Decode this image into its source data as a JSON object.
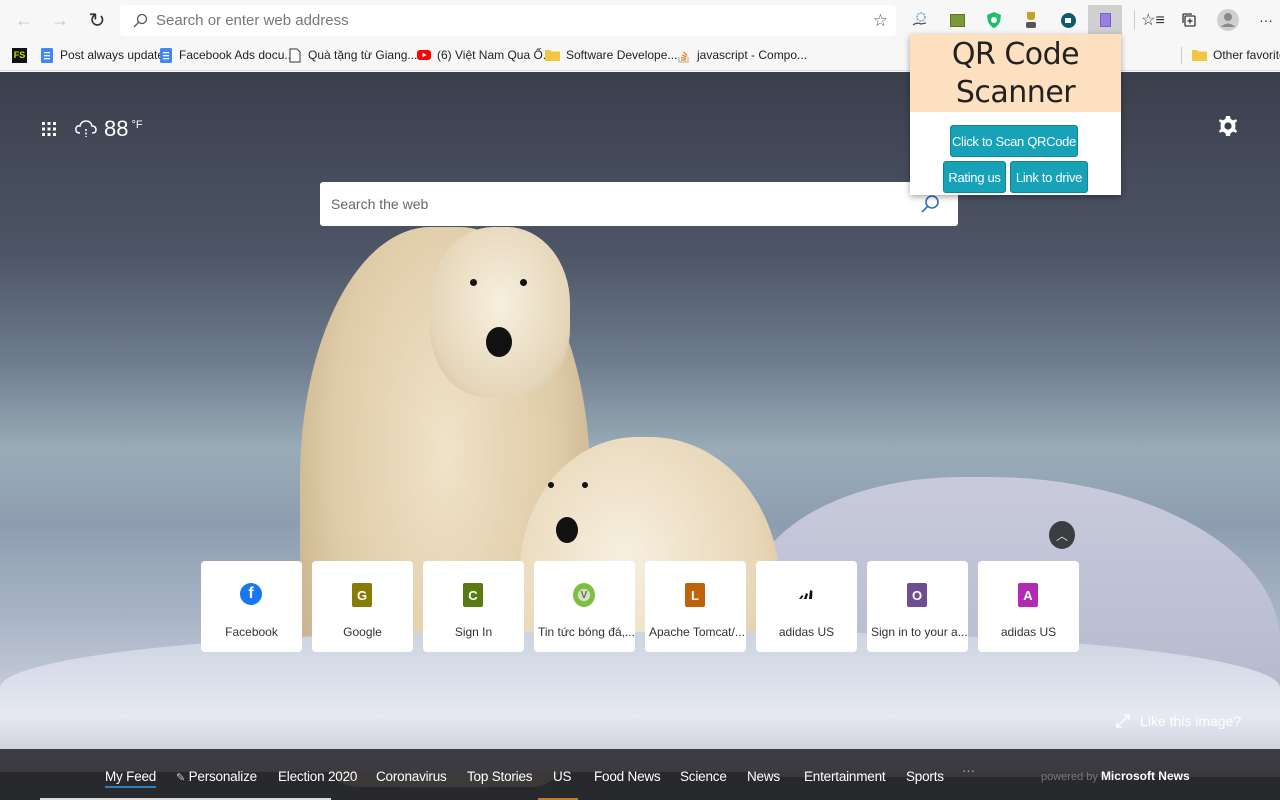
{
  "browser": {
    "address_placeholder": "Search or enter web address",
    "extensions": [
      "brain-hand-extension",
      "green-card-extension",
      "shield-extension",
      "trophy-extension",
      "video-extension",
      "qr-scanner-extension"
    ],
    "bookmarks": [
      {
        "label": "",
        "icon": "fs-icon"
      },
      {
        "label": "Post always update",
        "icon": "docs-icon"
      },
      {
        "label": "Facebook Ads docu...",
        "icon": "docs-icon"
      },
      {
        "label": "Quà tặng từ Giang...",
        "icon": "page-icon"
      },
      {
        "label": "(6) Việt Nam Qua Ố...",
        "icon": "youtube-icon"
      },
      {
        "label": "Software Develope...",
        "icon": "folder-icon"
      },
      {
        "label": "javascript - Compo...",
        "icon": "stackoverflow-icon"
      }
    ],
    "other_favorites": "Other favorites"
  },
  "popup": {
    "title": "QR Code Scanner",
    "scan_button": "Click to Scan QRCode",
    "rating_button": "Rating us",
    "drive_button": "Link to drive",
    "accent": "#17a2b8",
    "header_bg": "#fde0bf"
  },
  "newtab": {
    "weather": {
      "temp": "88",
      "unit": "°F"
    },
    "search_placeholder": "Search the web",
    "tiles": [
      {
        "label": "Facebook",
        "letter": "f",
        "color": "#1877f2",
        "icon": "facebook-icon"
      },
      {
        "label": "Google",
        "letter": "G",
        "color": "#8a7a06",
        "icon": "letter-g-icon"
      },
      {
        "label": "Sign In",
        "letter": "C",
        "color": "#5a7a12",
        "icon": "letter-c-icon"
      },
      {
        "label": "Tin tức bóng đá,...",
        "letter": "V",
        "color": "#7fbf3f",
        "icon": "soccer-site-icon"
      },
      {
        "label": "Apache Tomcat/...",
        "letter": "L",
        "color": "#c0620a",
        "icon": "letter-l-icon"
      },
      {
        "label": "adidas US",
        "letter": "",
        "color": "#ffffff",
        "icon": "adidas-icon"
      },
      {
        "label": "Sign in to your a...",
        "letter": "O",
        "color": "#6b4f92",
        "icon": "letter-o-icon"
      },
      {
        "label": "adidas US",
        "letter": "A",
        "color": "#b12bb3",
        "icon": "letter-a-icon"
      }
    ],
    "like_image": "Like this image?",
    "feed": [
      "My Feed",
      "Personalize",
      "Election 2020",
      "Coronavirus",
      "Top Stories",
      "US",
      "Food News",
      "Science",
      "News",
      "Entertainment",
      "Sports"
    ],
    "more": "···",
    "powered_by": "powered by",
    "powered_brand": "Microsoft News"
  }
}
